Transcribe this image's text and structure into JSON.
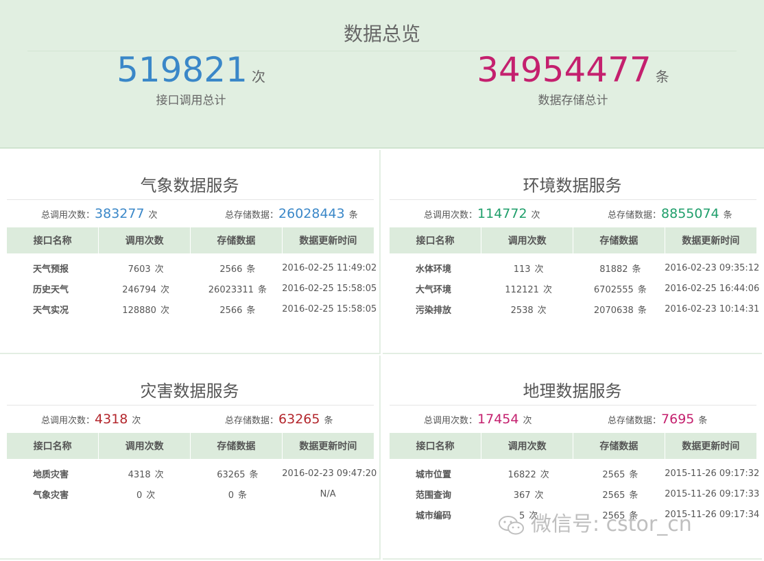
{
  "overview": {
    "title": "数据总览",
    "calls": {
      "value": "519821",
      "unit": "次",
      "caption": "接口调用总计"
    },
    "storage": {
      "value": "34954477",
      "unit": "条",
      "caption": "数据存储总计"
    }
  },
  "headers": [
    "接口名称",
    "调用次数",
    "存储数据",
    "数据更新时间"
  ],
  "labels": {
    "total_calls": "总调用次数：",
    "total_storage": "总存储数据：",
    "call_unit": "次",
    "row_unit": "条"
  },
  "panels": [
    {
      "title": "气象数据服务",
      "total_calls": "383277",
      "total_storage": "26028443",
      "rows": [
        {
          "name": "天气预报",
          "calls": "7603",
          "storage": "2566",
          "updated": "2016-02-25 11:49:02"
        },
        {
          "name": "历史天气",
          "calls": "246794",
          "storage": "26023311",
          "updated": "2016-02-25 15:58:05"
        },
        {
          "name": "天气实况",
          "calls": "128880",
          "storage": "2566",
          "updated": "2016-02-25 15:58:05"
        }
      ]
    },
    {
      "title": "环境数据服务",
      "total_calls": "114772",
      "total_storage": "8855074",
      "rows": [
        {
          "name": "水体环境",
          "calls": "113",
          "storage": "81882",
          "updated": "2016-02-23 09:35:12"
        },
        {
          "name": "大气环境",
          "calls": "112121",
          "storage": "6702555",
          "updated": "2016-02-25 16:44:06"
        },
        {
          "name": "污染排放",
          "calls": "2538",
          "storage": "2070638",
          "updated": "2016-02-23 10:14:31"
        }
      ]
    },
    {
      "title": "灾害数据服务",
      "total_calls": "4318",
      "total_storage": "63265",
      "rows": [
        {
          "name": "地质灾害",
          "calls": "4318",
          "storage": "63265",
          "updated": "2016-02-23 09:47:20"
        },
        {
          "name": "气象灾害",
          "calls": "0",
          "storage": "0",
          "updated": "N/A"
        }
      ]
    },
    {
      "title": "地理数据服务",
      "total_calls": "17454",
      "total_storage": "7695",
      "rows": [
        {
          "name": "城市位置",
          "calls": "16822",
          "storage": "2565",
          "updated": "2015-11-26 09:17:32"
        },
        {
          "name": "范围查询",
          "calls": "367",
          "storage": "2565",
          "updated": "2015-11-26 09:17:33"
        },
        {
          "name": "城市编码",
          "calls": "5",
          "storage": "2565",
          "updated": "2015-11-26 09:17:34"
        }
      ]
    }
  ],
  "watermark": {
    "text": "微信号: cstor_cn",
    "icon": "wechat-icon"
  }
}
